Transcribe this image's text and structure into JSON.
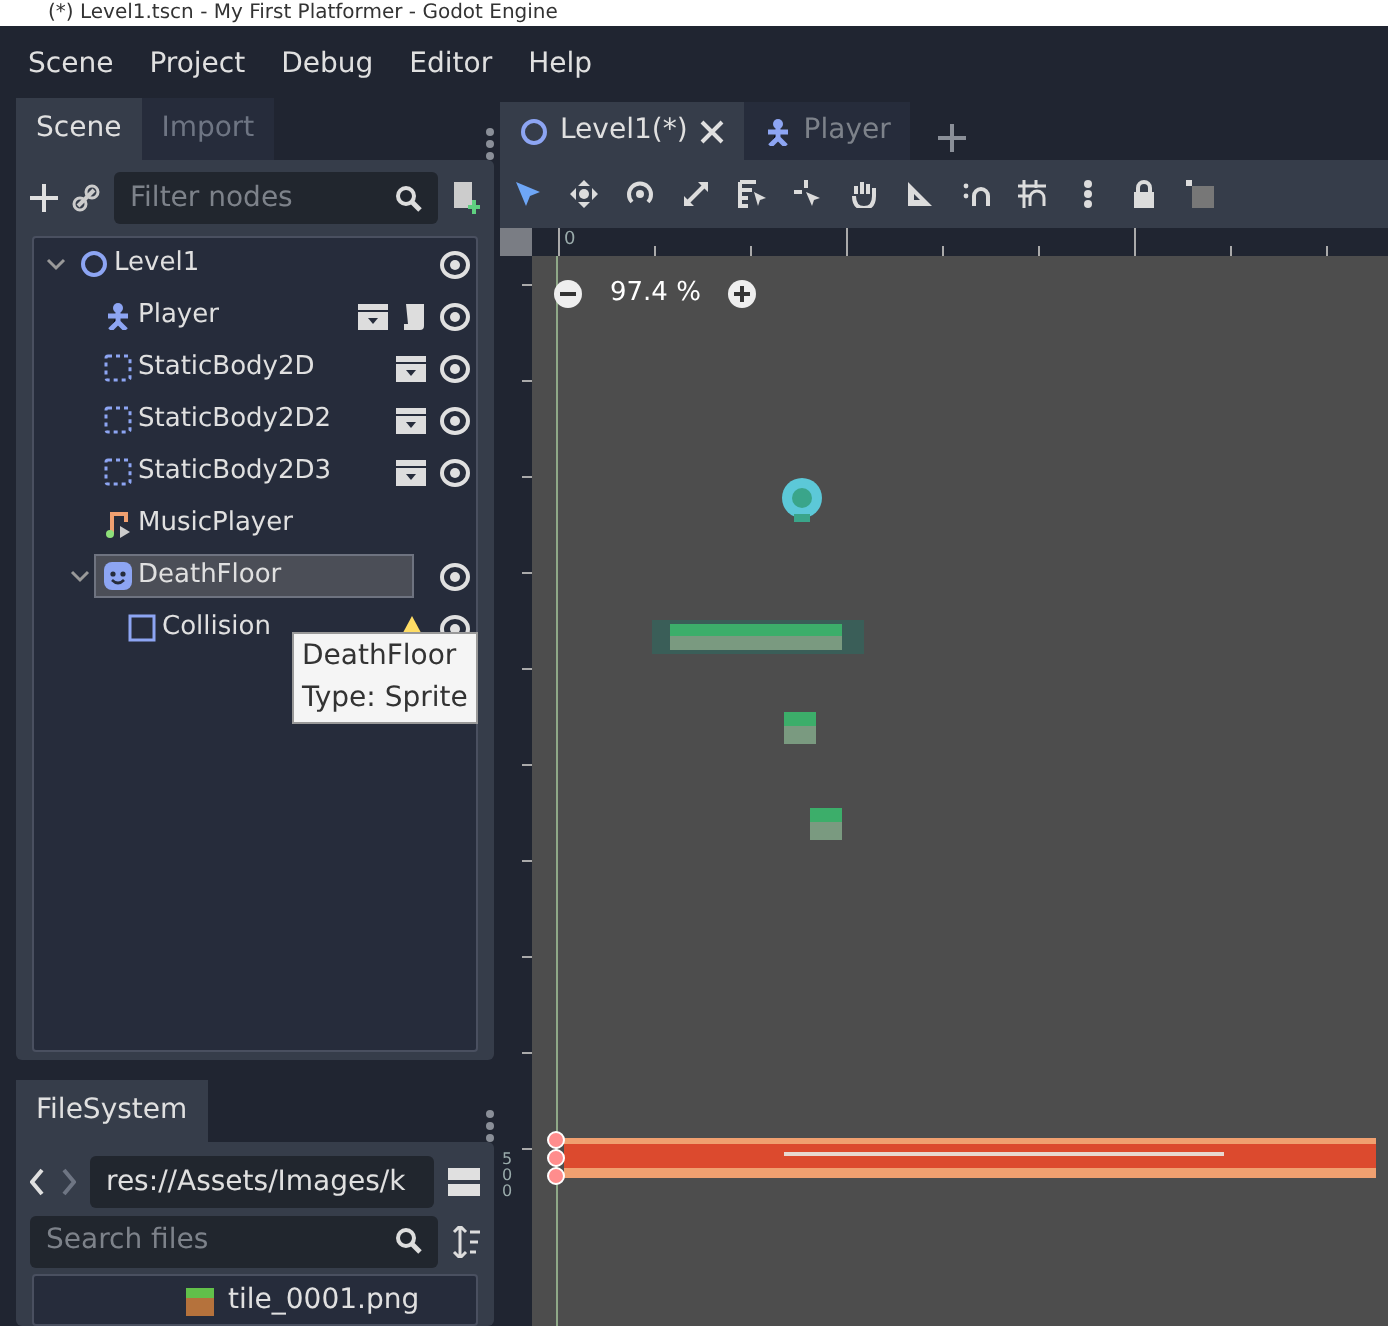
{
  "window": {
    "title": "(*) Level1.tscn - My First Platformer - Godot Engine"
  },
  "menu": [
    "Scene",
    "Project",
    "Debug",
    "Editor",
    "Help"
  ],
  "scene_dock": {
    "tabs": [
      {
        "label": "Scene",
        "selected": true
      },
      {
        "label": "Import",
        "selected": false
      }
    ],
    "filter": {
      "placeholder": "Filter nodes"
    },
    "tree": [
      {
        "name": "Level1",
        "kind": "node2d",
        "expanded": true,
        "selected": false,
        "instanced": false,
        "script": false,
        "visible_eye": true,
        "warning": false,
        "children": [
          {
            "name": "Player",
            "kind": "player",
            "selected": false,
            "instanced": true,
            "script": true,
            "visible_eye": true,
            "warning": false
          },
          {
            "name": "StaticBody2D",
            "kind": "body",
            "selected": false,
            "instanced": true,
            "script": false,
            "visible_eye": true,
            "warning": false
          },
          {
            "name": "StaticBody2D2",
            "kind": "body",
            "selected": false,
            "instanced": true,
            "script": false,
            "visible_eye": true,
            "warning": false
          },
          {
            "name": "StaticBody2D3",
            "kind": "body",
            "selected": false,
            "instanced": true,
            "script": false,
            "visible_eye": true,
            "warning": false
          },
          {
            "name": "MusicPlayer",
            "kind": "audio",
            "selected": false,
            "instanced": false,
            "script": false,
            "visible_eye": false,
            "warning": false
          },
          {
            "name": "DeathFloor",
            "kind": "sprite",
            "expanded": true,
            "selected": true,
            "instanced": false,
            "script": false,
            "visible_eye": true,
            "warning": false,
            "children": [
              {
                "name": "Collision",
                "kind": "shape",
                "selected": false,
                "instanced": false,
                "script": false,
                "visible_eye": true,
                "warning": true
              }
            ]
          }
        ]
      }
    ],
    "tooltip": [
      "DeathFloor",
      "Type: Sprite"
    ]
  },
  "filesystem": {
    "tab": "FileSystem",
    "path": "res://Assets/Images/k",
    "search": {
      "placeholder": "Search files"
    },
    "files": [
      "tile_0001.png"
    ]
  },
  "editor_tabs": [
    {
      "label": "Level1(*)",
      "kind": "scene",
      "selected": true
    },
    {
      "label": "Player",
      "kind": "player",
      "selected": false
    }
  ],
  "viewport": {
    "zoom": "97.4 %",
    "ruler_labels": [
      "0",
      "500"
    ]
  }
}
